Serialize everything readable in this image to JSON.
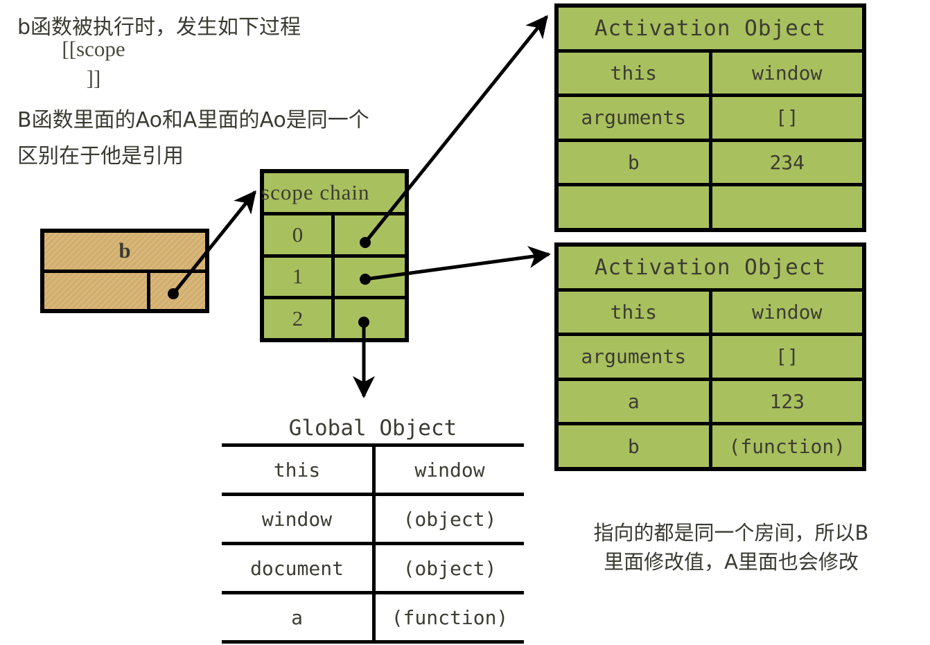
{
  "notes": {
    "note1": "b函数被执行时，发生如下过程",
    "note2": "B函数里面的Ao和A里面的Ao是同一个\n区别在于他是引用",
    "note3": "指向的都是同一个房间，所以B\n里面修改值，A里面也会修改"
  },
  "b_box": {
    "name": "b",
    "scope_label": "[[scope\n]]",
    "pointer_slot": ""
  },
  "scope_chain": {
    "title": "scope chain",
    "rows": [
      {
        "index": "0",
        "value": ""
      },
      {
        "index": "1",
        "value": ""
      },
      {
        "index": "2",
        "value": ""
      }
    ]
  },
  "activation_object_top": {
    "title": "Activation Object",
    "rows": [
      {
        "key": "this",
        "value": "window"
      },
      {
        "key": "arguments",
        "value": "[]"
      },
      {
        "key": "b",
        "value": "234"
      },
      {
        "key": "",
        "value": ""
      }
    ]
  },
  "activation_object_bottom": {
    "title": "Activation Object",
    "rows": [
      {
        "key": "this",
        "value": "window"
      },
      {
        "key": "arguments",
        "value": "[]"
      },
      {
        "key": "a",
        "value": "123"
      },
      {
        "key": "b",
        "value": "(function)"
      }
    ]
  },
  "global_object": {
    "title": "Global Object",
    "rows": [
      {
        "key": "this",
        "value": "window"
      },
      {
        "key": "window",
        "value": "(object)"
      },
      {
        "key": "document",
        "value": "(object)"
      },
      {
        "key": "a",
        "value": "(function)"
      }
    ]
  },
  "colors": {
    "green_fill": "#a9c05e",
    "orange_fill": "#d2ae6d",
    "stroke": "#000000",
    "text": "#3c3c33"
  }
}
